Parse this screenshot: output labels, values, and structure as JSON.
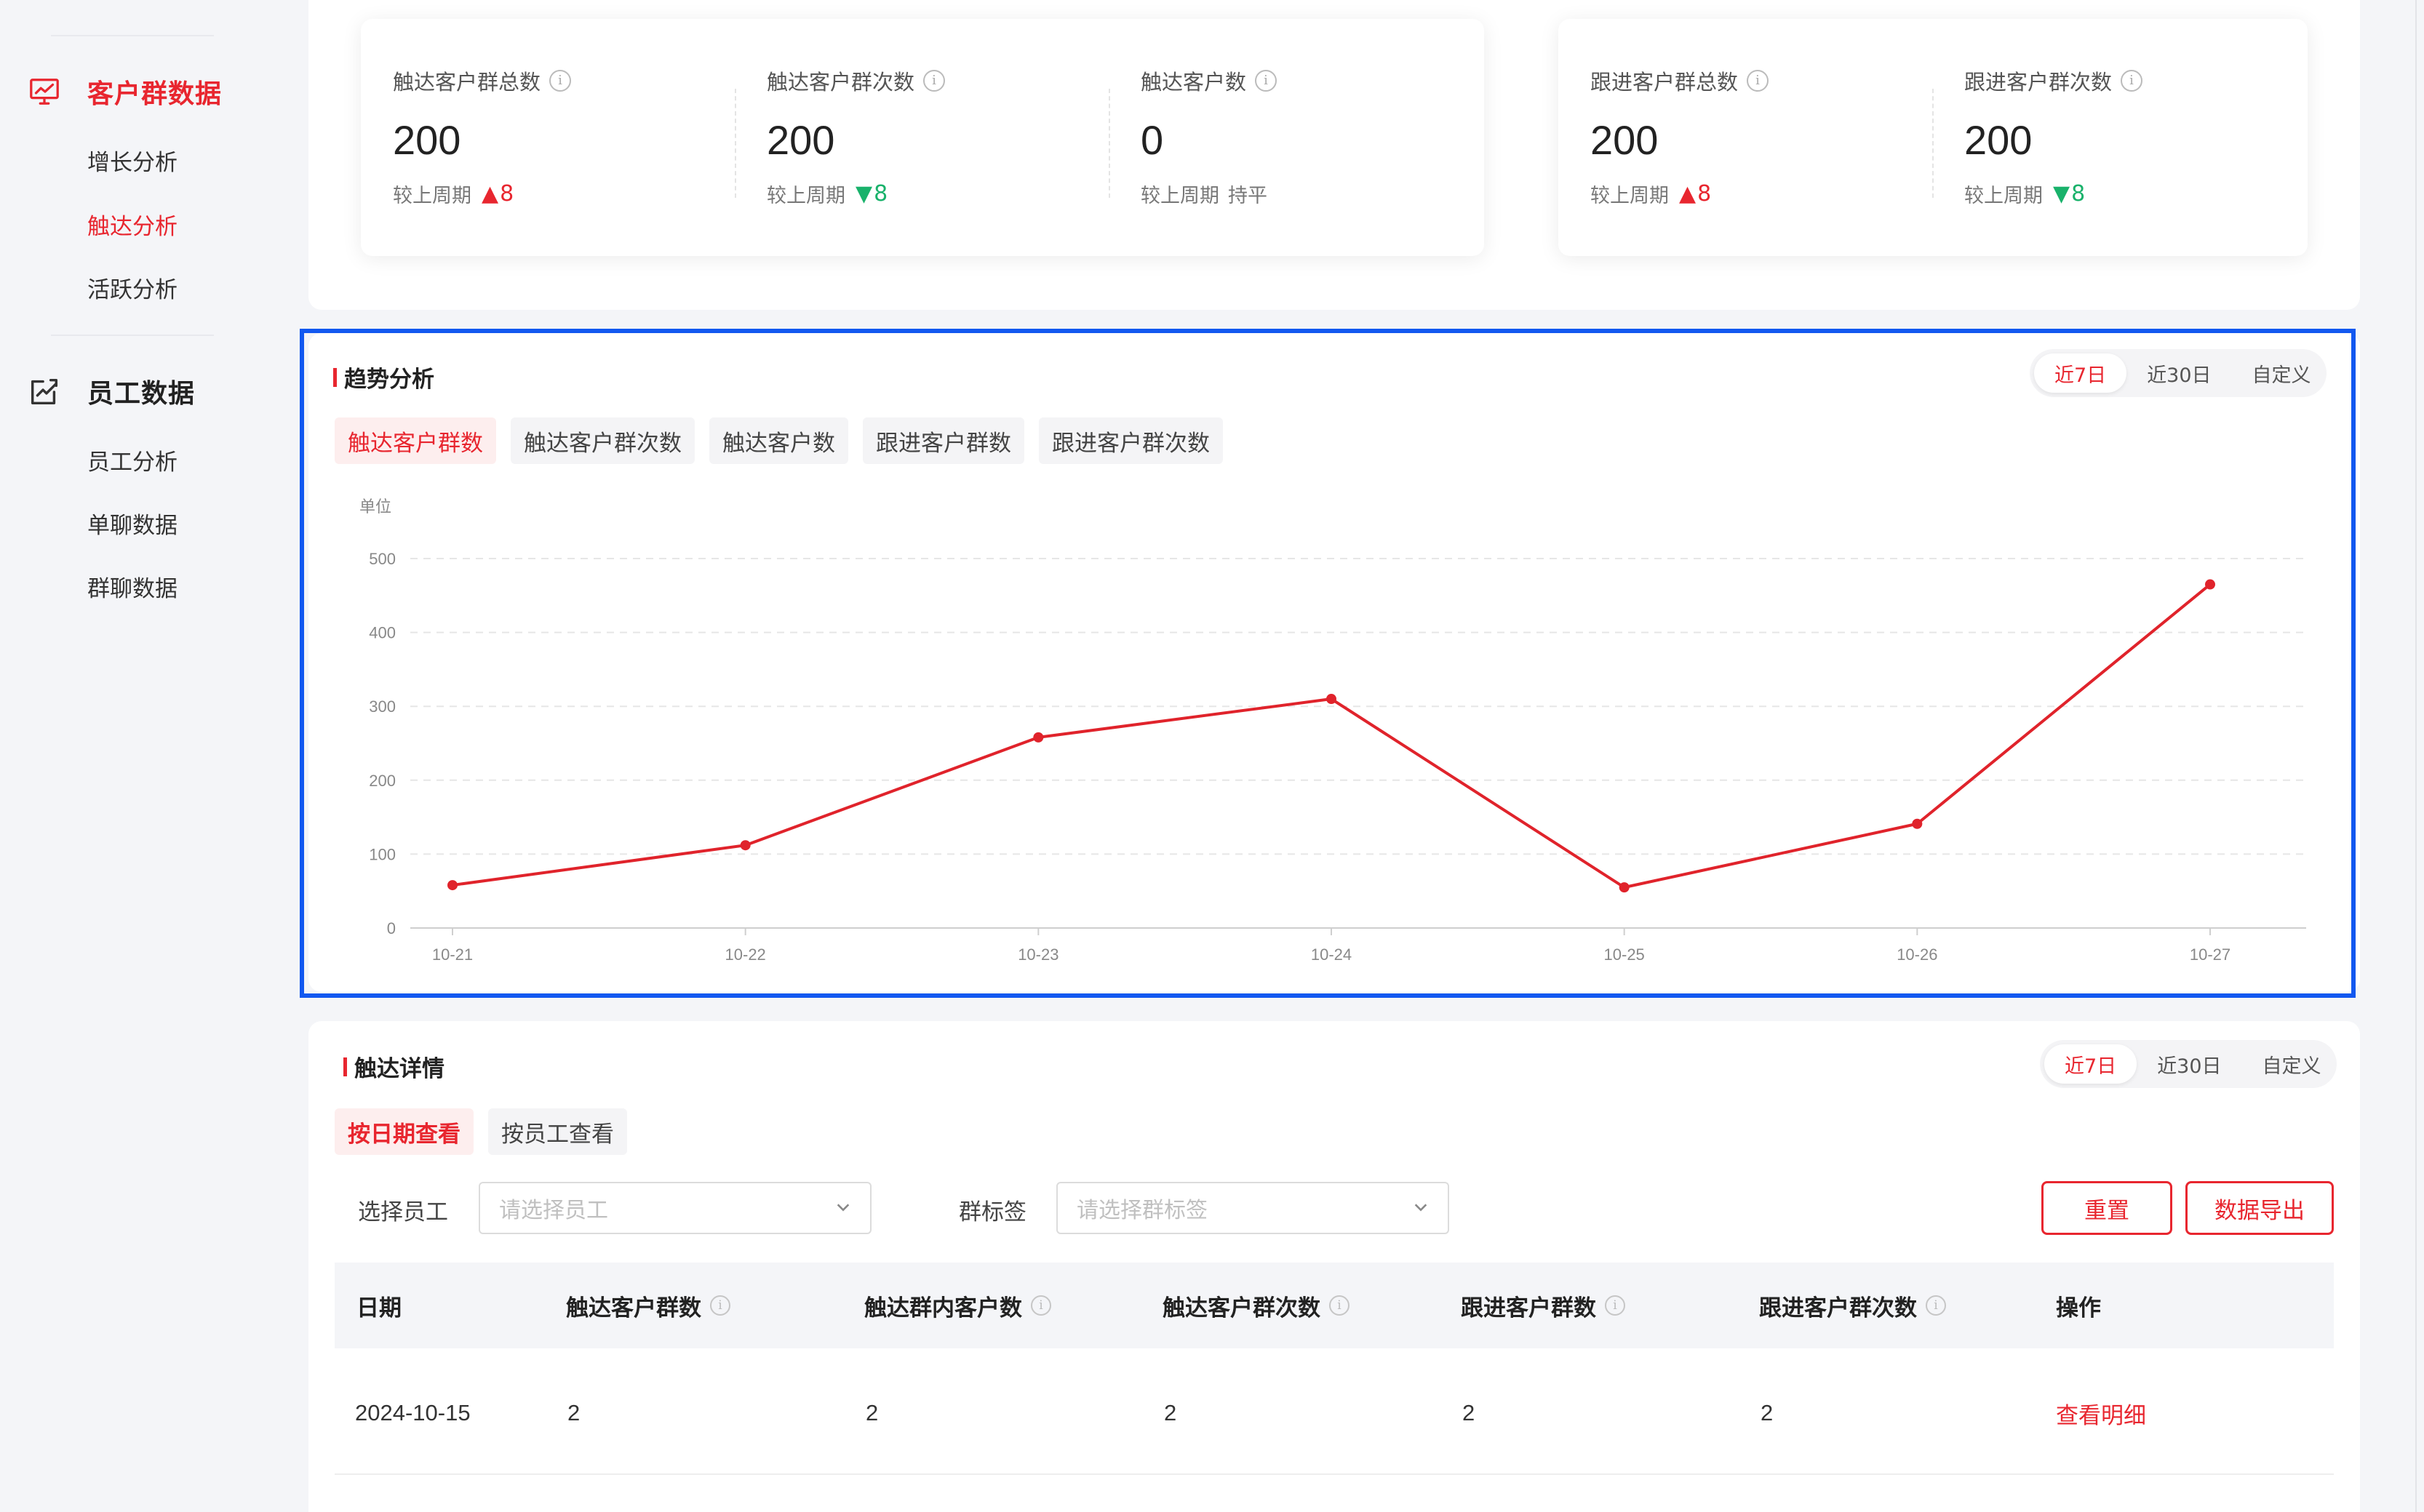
{
  "sidebar": {
    "groups": [
      {
        "label": "客户群数据",
        "icon": "monitor-chart-icon",
        "items": [
          {
            "label": "增长分析"
          },
          {
            "label": "触达分析"
          },
          {
            "label": "活跃分析"
          }
        ]
      },
      {
        "label": "员工数据",
        "icon": "edit-chart-icon",
        "items": [
          {
            "label": "员工分析"
          },
          {
            "label": "单聊数据"
          },
          {
            "label": "群聊数据"
          }
        ]
      }
    ]
  },
  "summary": {
    "reach": [
      {
        "title": "触达客户群总数",
        "value": "200",
        "compare_label": "较上周期",
        "trend": "up",
        "delta": "8"
      },
      {
        "title": "触达客户群次数",
        "value": "200",
        "compare_label": "较上周期",
        "trend": "down",
        "delta": "8"
      },
      {
        "title": "触达客户数",
        "value": "0",
        "compare_label": "较上周期",
        "trend": "flat",
        "delta": "持平"
      }
    ],
    "follow": [
      {
        "title": "跟进客户群总数",
        "value": "200",
        "compare_label": "较上周期",
        "trend": "up",
        "delta": "8"
      },
      {
        "title": "跟进客户群次数",
        "value": "200",
        "compare_label": "较上周期",
        "trend": "down",
        "delta": "8"
      }
    ],
    "info_glyph": "i"
  },
  "trend": {
    "title": "趋势分析",
    "range_options": [
      "近7日",
      "近30日",
      "自定义"
    ],
    "range_selected": "近7日",
    "metric_tabs": [
      "触达客户群数",
      "触达客户群次数",
      "触达客户数",
      "跟进客户群数",
      "跟进客户群次数"
    ],
    "metric_selected": "触达客户群数"
  },
  "chart_data": {
    "type": "line",
    "ylabel": "单位",
    "x": [
      "10-21",
      "10-22",
      "10-23",
      "10-24",
      "10-25",
      "10-26",
      "10-27"
    ],
    "series": [
      {
        "values": [
          58,
          112,
          258,
          310,
          55,
          141,
          465
        ],
        "color": "#e0232b"
      }
    ],
    "ylim": [
      0,
      500
    ],
    "yticks": [
      0,
      100,
      200,
      300,
      400,
      500
    ],
    "grid": true
  },
  "detail": {
    "title": "触达详情",
    "range_options": [
      "近7日",
      "近30日",
      "自定义"
    ],
    "range_selected": "近7日",
    "view_tabs": [
      "按日期查看",
      "按员工查看"
    ],
    "view_selected": "按日期查看",
    "filters": {
      "employee_label": "选择员工",
      "employee_placeholder": "请选择员工",
      "tag_label": "群标签",
      "tag_placeholder": "请选择群标签"
    },
    "buttons": {
      "reset": "重置",
      "export": "数据导出"
    },
    "columns": [
      {
        "label": "日期",
        "info": false
      },
      {
        "label": "触达客户群数",
        "info": true
      },
      {
        "label": "触达群内客户数",
        "info": true
      },
      {
        "label": "触达客户群次数",
        "info": true
      },
      {
        "label": "跟进客户群数",
        "info": true
      },
      {
        "label": "跟进客户群次数",
        "info": true
      },
      {
        "label": "操作",
        "info": false
      }
    ],
    "rows": [
      {
        "date": "2024-10-15",
        "reach_groups": "2",
        "reach_members": "2",
        "reach_times": "2",
        "follow_groups": "2",
        "follow_times": "2",
        "action": "查看明细"
      }
    ]
  },
  "colors": {
    "accent": "#e8262f",
    "up": "#e8262f",
    "down": "#19b26b",
    "highlight": "#1258f0"
  }
}
